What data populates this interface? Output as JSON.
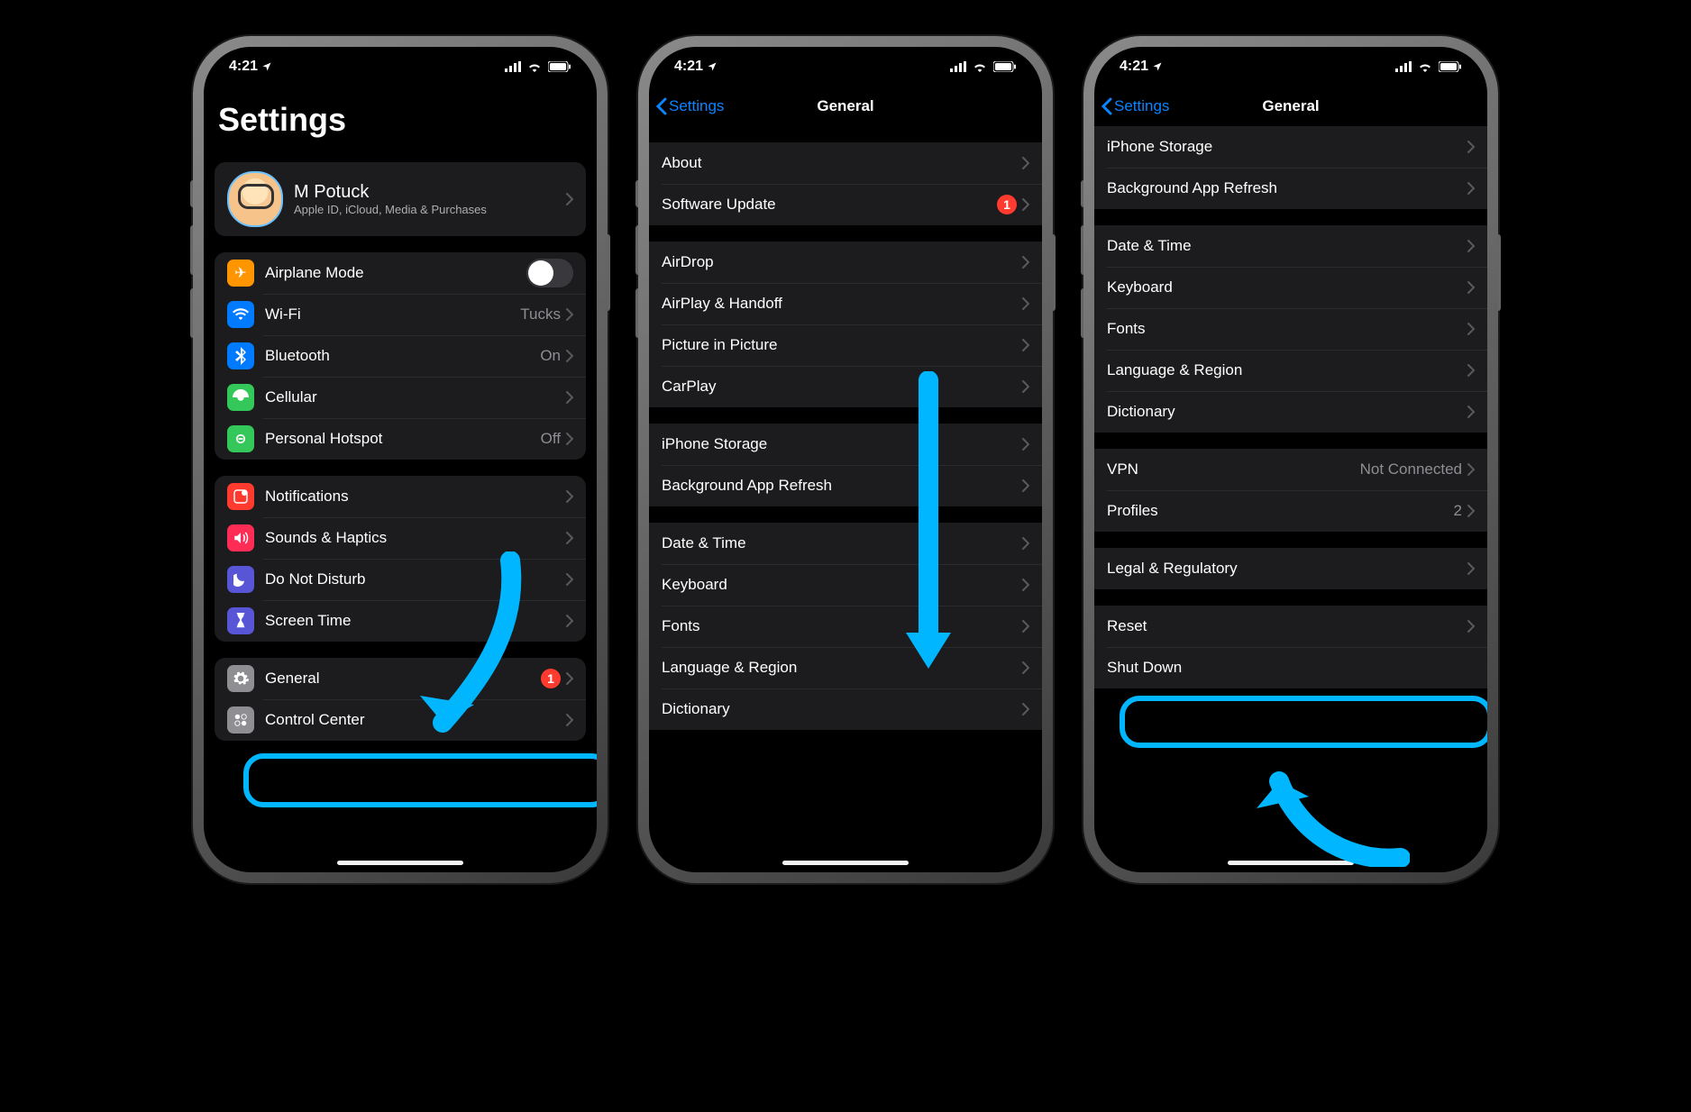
{
  "status": {
    "time": "4:21"
  },
  "colors": {
    "highlight": "#00b7ff",
    "link": "#0a84ff",
    "badge": "#ff3b30"
  },
  "screen1": {
    "title": "Settings",
    "profile": {
      "name": "M Potuck",
      "subtitle": "Apple ID, iCloud, Media & Purchases"
    },
    "groupA": [
      {
        "icon": "airplane",
        "label": "Airplane Mode",
        "toggle": false
      },
      {
        "icon": "wifi",
        "label": "Wi-Fi",
        "value": "Tucks"
      },
      {
        "icon": "bluetooth",
        "label": "Bluetooth",
        "value": "On"
      },
      {
        "icon": "cellular",
        "label": "Cellular"
      },
      {
        "icon": "hotspot",
        "label": "Personal Hotspot",
        "value": "Off"
      }
    ],
    "groupB": [
      {
        "icon": "notifications",
        "label": "Notifications"
      },
      {
        "icon": "sounds",
        "label": "Sounds & Haptics"
      },
      {
        "icon": "dnd",
        "label": "Do Not Disturb"
      },
      {
        "icon": "screentime",
        "label": "Screen Time"
      }
    ],
    "groupC": [
      {
        "icon": "general",
        "label": "General",
        "badge": "1"
      },
      {
        "icon": "controlcenter",
        "label": "Control Center"
      }
    ]
  },
  "screen2": {
    "back": "Settings",
    "title": "General",
    "groupA": [
      {
        "label": "About"
      },
      {
        "label": "Software Update",
        "badge": "1"
      }
    ],
    "groupB": [
      {
        "label": "AirDrop"
      },
      {
        "label": "AirPlay & Handoff"
      },
      {
        "label": "Picture in Picture"
      },
      {
        "label": "CarPlay"
      }
    ],
    "groupC": [
      {
        "label": "iPhone Storage"
      },
      {
        "label": "Background App Refresh"
      }
    ],
    "groupD": [
      {
        "label": "Date & Time"
      },
      {
        "label": "Keyboard"
      },
      {
        "label": "Fonts"
      },
      {
        "label": "Language & Region"
      },
      {
        "label": "Dictionary"
      }
    ]
  },
  "screen3": {
    "back": "Settings",
    "title": "General",
    "groupA": [
      {
        "label": "iPhone Storage"
      },
      {
        "label": "Background App Refresh"
      }
    ],
    "groupB": [
      {
        "label": "Date & Time"
      },
      {
        "label": "Keyboard"
      },
      {
        "label": "Fonts"
      },
      {
        "label": "Language & Region"
      },
      {
        "label": "Dictionary"
      }
    ],
    "groupC": [
      {
        "label": "VPN",
        "value": "Not Connected"
      },
      {
        "label": "Profiles",
        "value": "2"
      }
    ],
    "groupD": [
      {
        "label": "Legal & Regulatory"
      }
    ],
    "groupE": [
      {
        "label": "Reset"
      },
      {
        "label": "Shut Down",
        "link": true,
        "nochev": true
      }
    ]
  }
}
